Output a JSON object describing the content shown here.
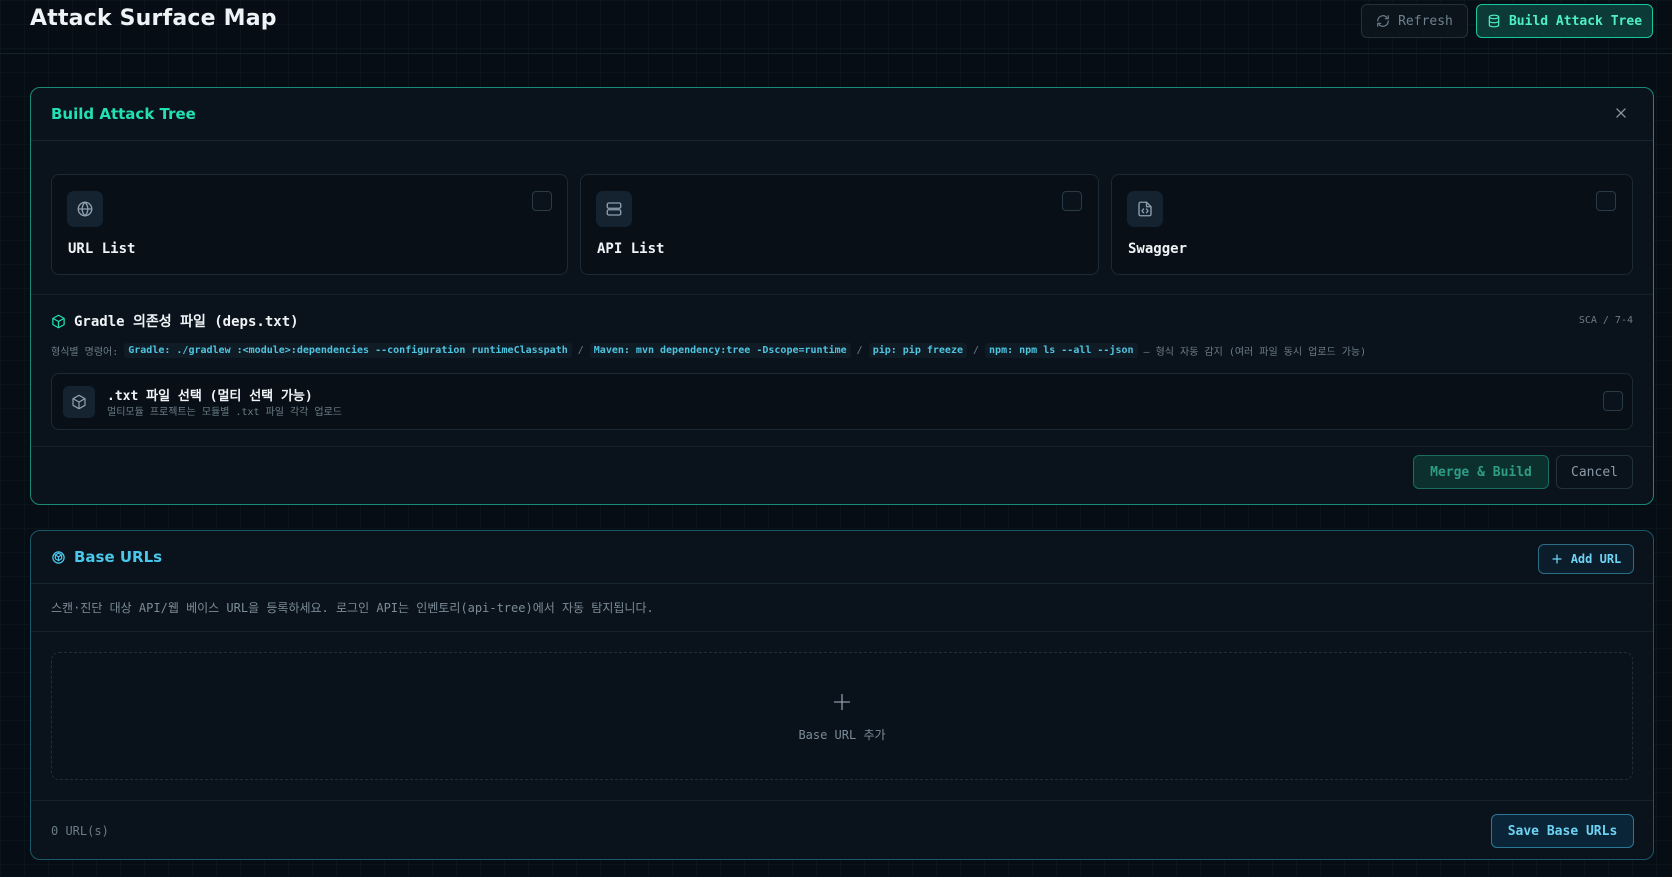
{
  "header": {
    "title": "Attack Surface Map",
    "refresh_label": "Refresh",
    "build_label": "Build Attack Tree"
  },
  "build_panel": {
    "title": "Build Attack Tree",
    "sources": [
      {
        "label": "URL List",
        "icon": "globe-icon",
        "checked": false
      },
      {
        "label": "API List",
        "icon": "server-icon",
        "checked": false
      },
      {
        "label": "Swagger",
        "icon": "file-code-icon",
        "checked": false
      }
    ],
    "gradle": {
      "title": "Gradle 의존성 파일 (deps.txt)",
      "tag": "SCA / 7-4",
      "cmd_prefix": "형식별 명령어:",
      "cmds": [
        "Gradle: ./gradlew :<module>:dependencies --configuration runtimeClasspath",
        "Maven: mvn dependency:tree -Dscope=runtime",
        "pip: pip freeze",
        "npm: npm ls --all --json"
      ],
      "separator": "/",
      "cmd_suffix": "— 형식 자동 감지 (여러 파일 동시 업로드 가능)",
      "file_title": ".txt 파일 선택 (멀티 선택 가능)",
      "file_sub": "멀티모듈 프로젝트는 모듈별 .txt 파일 각각 업로드"
    },
    "merge_label": "Merge & Build",
    "cancel_label": "Cancel"
  },
  "base_panel": {
    "title": "Base URLs",
    "add_label": "Add URL",
    "description": "스캔·진단 대상 API/웹 베이스 URL을 등록하세요. 로그인 API는 인벤토리(api-tree)에서 자동 탐지됩니다.",
    "dropzone_label": "Base URL 추가",
    "count_text": "0 URL(s)",
    "save_label": "Save Base URLs"
  },
  "colors": {
    "accent_teal": "#22e0b4",
    "accent_cyan": "#49c8ec",
    "background": "#070d14"
  }
}
